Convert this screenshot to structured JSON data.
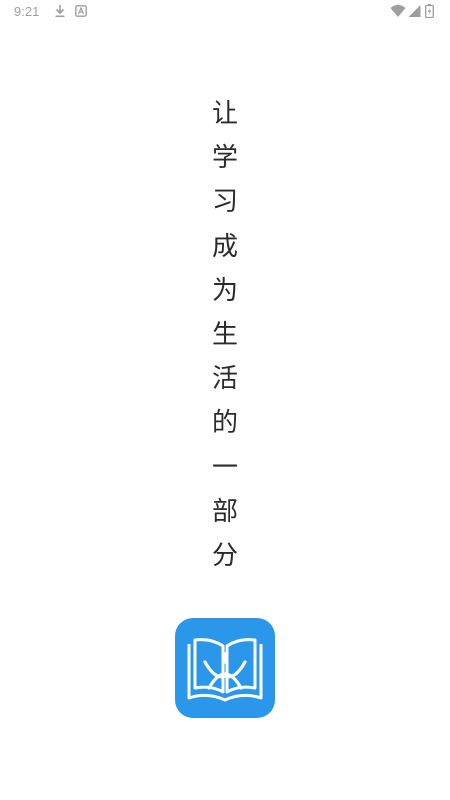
{
  "status_bar": {
    "time": "9:21",
    "icons": [
      "download-icon",
      "a-icon",
      "wifi-icon",
      "signal-icon",
      "battery-icon"
    ]
  },
  "slogan": {
    "characters": [
      "让",
      "学",
      "习",
      "成",
      "为",
      "生",
      "活",
      "的",
      "一",
      "部",
      "分"
    ]
  },
  "logo": {
    "icon": "open-book-icon",
    "background_color": "#2a97ea",
    "foreground_color": "#ffffff"
  }
}
